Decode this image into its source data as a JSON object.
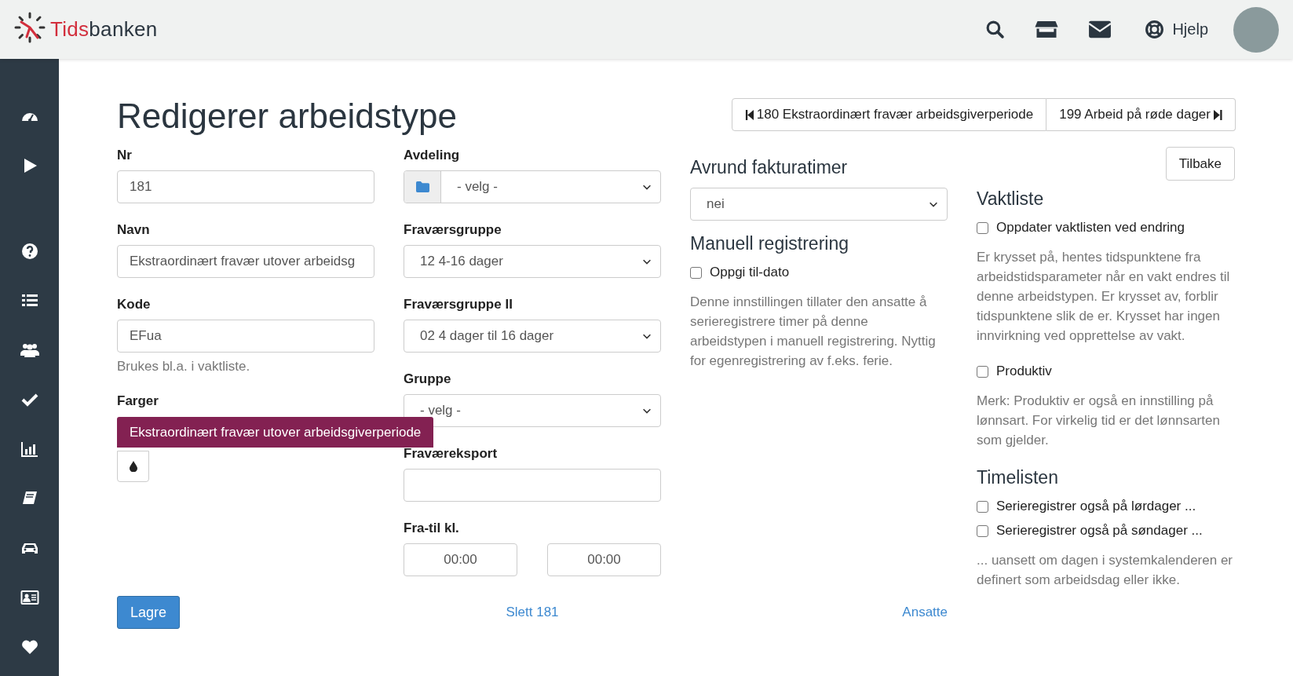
{
  "header": {
    "brand": {
      "accent": "Tids",
      "rest": "banken"
    },
    "help": "Hjelp"
  },
  "title": "Redigerer arbeidstype",
  "record_nav": {
    "previous": "180 Ekstraordinært fravær arbeidsgiverperiode",
    "next": "199 Arbeid på røde dager"
  },
  "back_button": "Tilbake",
  "column_1": [
    {
      "kind": "text",
      "label": "Nr",
      "value": "181"
    },
    {
      "kind": "text",
      "label": "Navn",
      "value": "Ekstraordinært fravær utover arbeidsg"
    },
    {
      "kind": "text",
      "label": "Kode",
      "value": "EFua",
      "help": "Brukes bl.a. i vaktliste."
    },
    {
      "kind": "color",
      "label": "Farger",
      "chip": "Ekstraordinært fravær utover arbeidsgiverperiode",
      "color": "#832152"
    }
  ],
  "column_2": [
    {
      "kind": "select_icon",
      "label": "Avdeling",
      "value": "- velg -"
    },
    {
      "kind": "select",
      "label": "Fraværsgruppe",
      "value": "12 4-16 dager"
    },
    {
      "kind": "select",
      "label": "Fraværsgruppe II",
      "value": "02 4 dager til 16 dager"
    },
    {
      "kind": "select",
      "label": "Gruppe",
      "value": "- velg -"
    },
    {
      "kind": "text",
      "label": "Fraværeksport"
    },
    {
      "kind": "time_pair",
      "label": "Fra-til kl.",
      "values": [
        "00:00",
        "00:00"
      ]
    }
  ],
  "column_3": [
    {
      "kind": "select_section",
      "heading": "Avrund fakturatimer",
      "value": "nei"
    },
    {
      "kind": "check_section",
      "heading": "Manuell registrering",
      "checks": [
        {
          "label": "Oppgi til-dato",
          "checked": false
        }
      ],
      "note": "Denne innstillingen tillater den ansatte å serieregistrere timer på denne arbeidstypen i manuell registrering. Nyttig for egenregistrering av f.eks. ferie."
    }
  ],
  "column_4": [
    {
      "kind": "check_section",
      "heading": "Vaktliste",
      "checks": [
        {
          "label": "Oppdater vaktlisten ved endring",
          "checked": false
        }
      ],
      "note": "Er krysset på, hentes tidspunktene fra arbeidstidsparameter når en vakt endres til denne arbeidstypen. Er krysset av, forblir tidspunktene slik de er. Krysset har ingen innvirkning ved opprettelse av vakt."
    },
    {
      "kind": "check_section",
      "checks": [
        {
          "label": "Produktiv",
          "checked": false
        }
      ],
      "note": "Merk: Produktiv er også en innstilling på lønnsart. For virkelig tid er det lønnsarten som gjelder."
    },
    {
      "kind": "check_section",
      "heading": "Timelisten",
      "checks": [
        {
          "label": "Serieregistrer også på lørdager ...",
          "checked": false
        },
        {
          "label": "Serieregistrer også på søndager ...",
          "checked": false
        }
      ],
      "note": "... uansett om dagen i systemkalenderen er definert som arbeidsdag eller ikke."
    }
  ],
  "footer": {
    "save": "Lagre",
    "delete": "Slett 181",
    "link": "Ansatte"
  }
}
